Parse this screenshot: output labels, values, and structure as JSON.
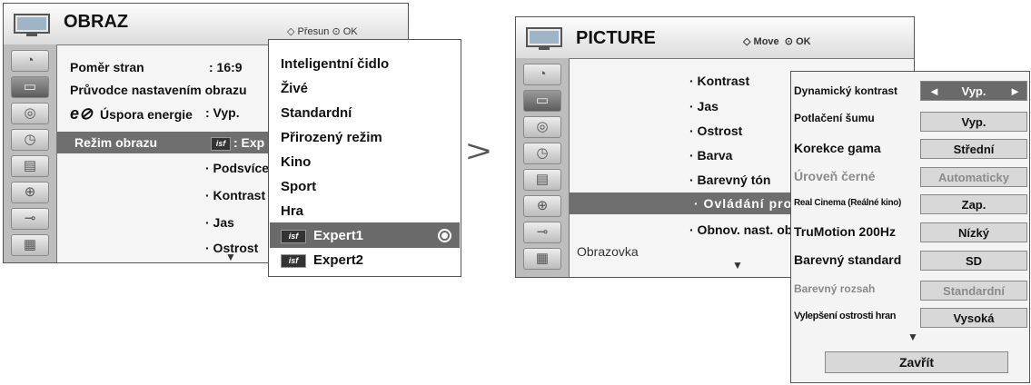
{
  "left_menu": {
    "title": "OBRAZ",
    "hint_move": "Přesun",
    "hint_ok": "OK",
    "rows": [
      {
        "label": "Poměr stran",
        "value": ": 16:9"
      },
      {
        "label": "Průvodce nastavením obrazu",
        "value": ""
      },
      {
        "label": "Úspora energie",
        "value": ": Vyp."
      },
      {
        "label": "Režim obrazu",
        "value": ": Exp"
      }
    ],
    "eco_prefix": "e",
    "sub_items": [
      "· Podsvíce",
      "· Kontrast",
      "· Jas",
      "· Ostrost"
    ],
    "more_arrow": "▼"
  },
  "mode_dropdown": {
    "items": [
      "Inteligentní čidlo",
      "Živé",
      "Standardní",
      "Přirozený režim",
      "Kino",
      "Sport",
      "Hra",
      "Expert1",
      "Expert2"
    ],
    "isf_label": "isf"
  },
  "step_arrow": ">",
  "right_menu": {
    "title": "PICTURE",
    "hint_move": "Move",
    "hint_ok": "OK",
    "items": [
      "· Kontrast",
      "· Jas",
      "· Ostrost",
      "· Barva",
      "· Barevný tón",
      "· Ovládání pro",
      "· Obnov. nast. ob"
    ],
    "section": "Obrazovka",
    "more_arrow": "▼"
  },
  "settings_popup": {
    "rows": [
      {
        "label": "Dynamický kontrast",
        "value": "Vyp."
      },
      {
        "label": "Potlačení šumu",
        "value": "Vyp."
      },
      {
        "label": "Korekce gama",
        "value": "Střední"
      },
      {
        "label": "Úroveň černé",
        "value": "Automaticky"
      },
      {
        "label": "Real Cinema (Reálné kino)",
        "value": "Zap."
      },
      {
        "label": "TruMotion 200Hz",
        "value": "Nízký"
      },
      {
        "label": "Barevný standard",
        "value": "SD"
      },
      {
        "label": "Barevný rozsah",
        "value": "Standardní"
      },
      {
        "label": "Vylepšení ostrosti hran",
        "value": "Vysoká"
      }
    ],
    "left_arrow": "◄",
    "right_arrow": "►",
    "more_arrow": "▼",
    "close_label": "Zavřít"
  }
}
